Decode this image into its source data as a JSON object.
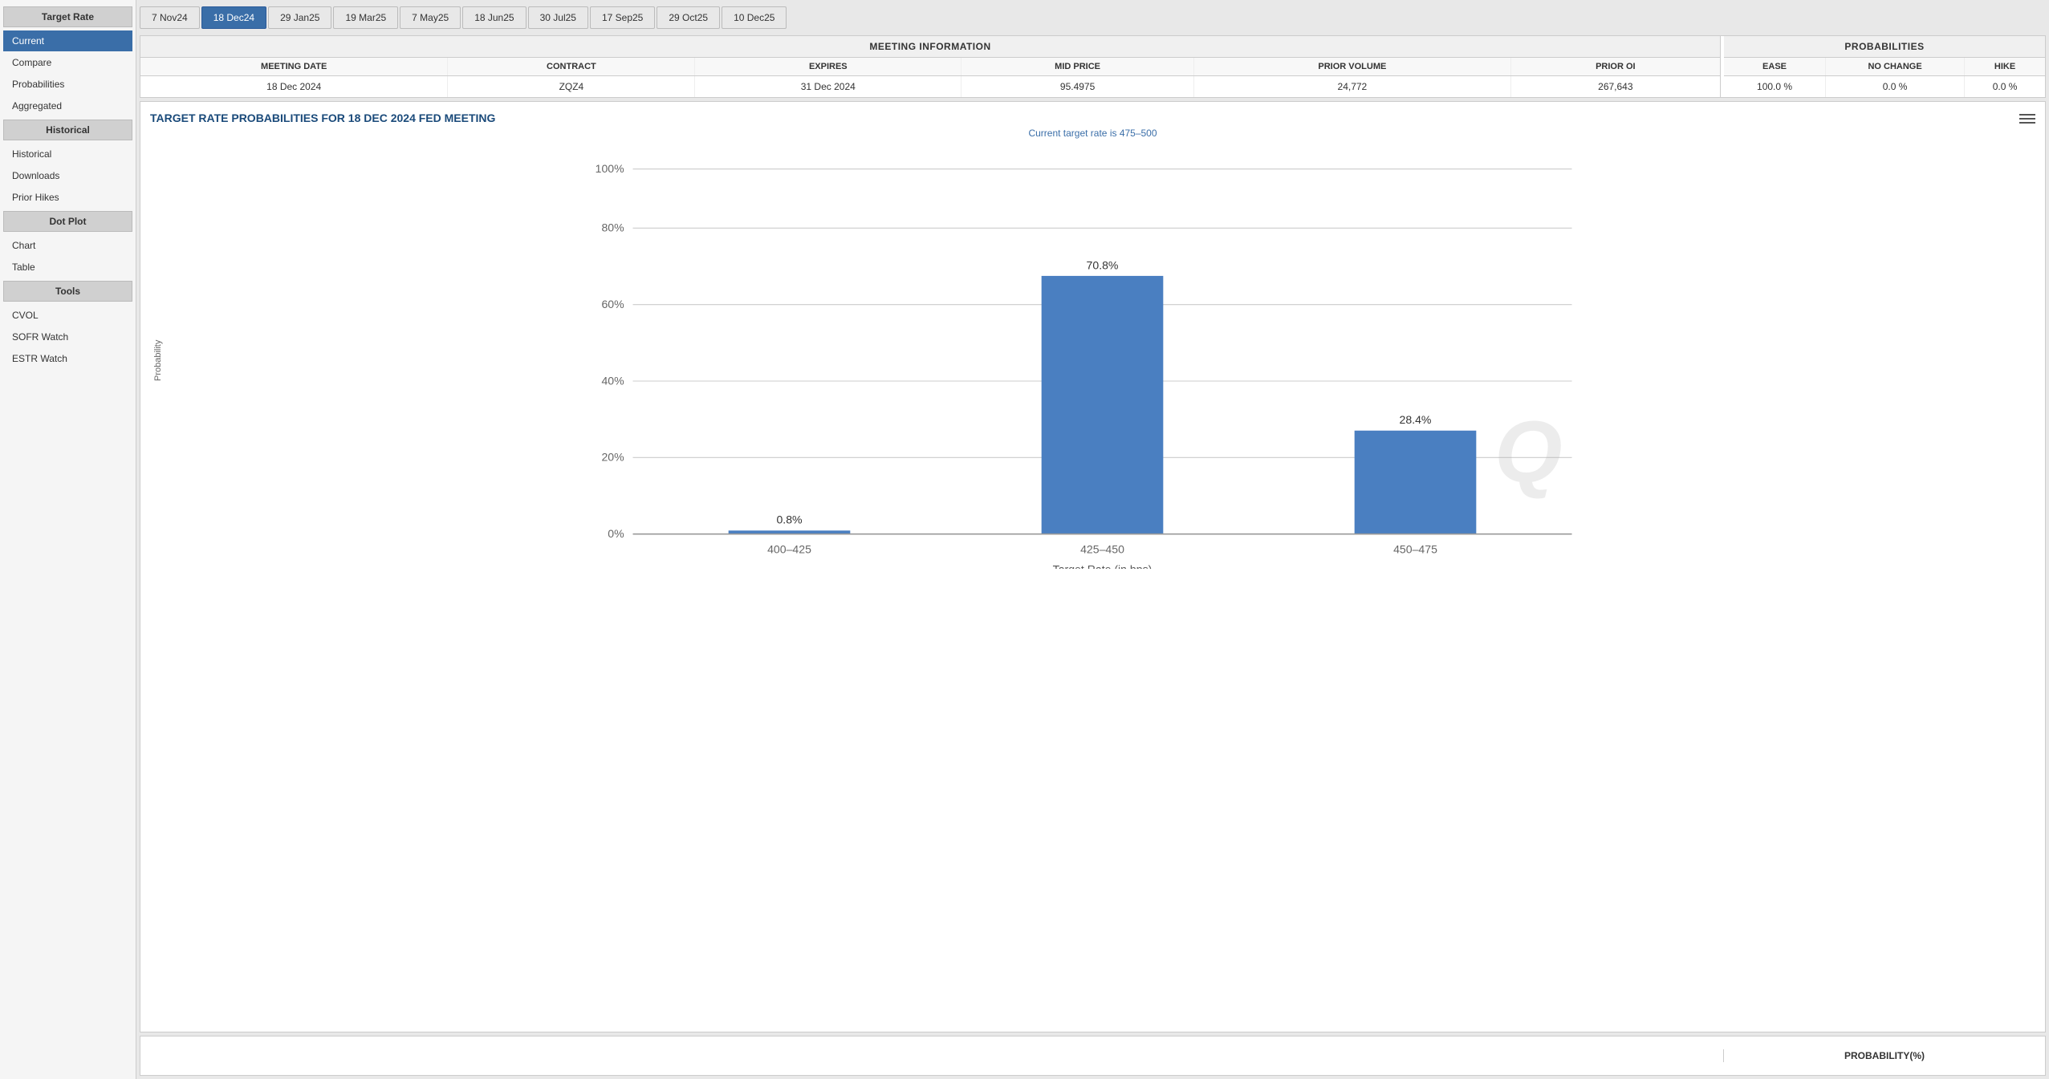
{
  "sidebar": {
    "target_rate_header": "Target Rate",
    "items_main": [
      {
        "label": "Current",
        "active": true,
        "id": "current"
      },
      {
        "label": "Compare",
        "active": false,
        "id": "compare"
      },
      {
        "label": "Probabilities",
        "active": false,
        "id": "probabilities"
      },
      {
        "label": "Aggregated",
        "active": false,
        "id": "aggregated"
      }
    ],
    "historical_header": "Historical",
    "items_historical": [
      {
        "label": "Historical",
        "active": false,
        "id": "historical"
      },
      {
        "label": "Downloads",
        "active": false,
        "id": "downloads"
      },
      {
        "label": "Prior Hikes",
        "active": false,
        "id": "prior-hikes"
      }
    ],
    "dot_plot_header": "Dot Plot",
    "items_dot_plot": [
      {
        "label": "Chart",
        "active": false,
        "id": "chart"
      },
      {
        "label": "Table",
        "active": false,
        "id": "table"
      }
    ],
    "tools_header": "Tools",
    "items_tools": [
      {
        "label": "CVOL",
        "active": false,
        "id": "cvol"
      },
      {
        "label": "SOFR Watch",
        "active": false,
        "id": "sofr-watch"
      },
      {
        "label": "ESTR Watch",
        "active": false,
        "id": "estr-watch"
      }
    ]
  },
  "date_tabs": [
    {
      "label": "7 Nov24",
      "active": false
    },
    {
      "label": "18 Dec24",
      "active": true
    },
    {
      "label": "29 Jan25",
      "active": false
    },
    {
      "label": "19 Mar25",
      "active": false
    },
    {
      "label": "7 May25",
      "active": false
    },
    {
      "label": "18 Jun25",
      "active": false
    },
    {
      "label": "30 Jul25",
      "active": false
    },
    {
      "label": "17 Sep25",
      "active": false
    },
    {
      "label": "29 Oct25",
      "active": false
    },
    {
      "label": "10 Dec25",
      "active": false
    }
  ],
  "meeting_info": {
    "panel_title": "MEETING INFORMATION",
    "columns": [
      "MEETING DATE",
      "CONTRACT",
      "EXPIRES",
      "MID PRICE",
      "PRIOR VOLUME",
      "PRIOR OI"
    ],
    "row": [
      "18 Dec 2024",
      "ZQZ4",
      "31 Dec 2024",
      "95.4975",
      "24,772",
      "267,643"
    ]
  },
  "probabilities": {
    "panel_title": "PROBABILITIES",
    "columns": [
      "EASE",
      "NO CHANGE",
      "HIKE"
    ],
    "row": [
      "100.0 %",
      "0.0 %",
      "0.0 %"
    ]
  },
  "chart": {
    "title": "TARGET RATE PROBABILITIES FOR 18 DEC 2024 FED MEETING",
    "subtitle": "Current target rate is 475–500",
    "y_axis_label": "Probability",
    "x_axis_label": "Target Rate (in bps)",
    "y_ticks": [
      "0%",
      "20%",
      "40%",
      "60%",
      "80%",
      "100%"
    ],
    "bars": [
      {
        "label": "400–425",
        "value": 0.8,
        "display": "0.8%"
      },
      {
        "label": "425–450",
        "value": 70.8,
        "display": "70.8%"
      },
      {
        "label": "450–475",
        "value": 28.4,
        "display": "28.4%"
      }
    ],
    "bar_color": "#4a7fc1",
    "watermark": "Q"
  },
  "bottom_panel": {
    "label": "PROBABILITY(%)"
  }
}
